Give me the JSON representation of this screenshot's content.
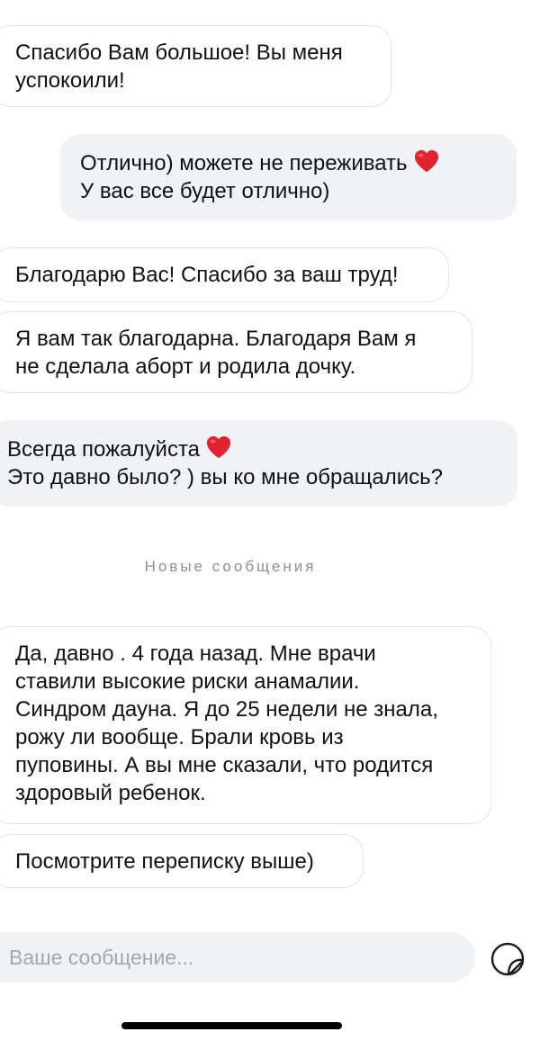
{
  "messages": [
    {
      "lines": [
        "Спасибо Вам большое! Вы меня",
        "успокоили!"
      ]
    },
    {
      "lines": [
        "Отлично) можете не переживать",
        "У вас все будет отлично)"
      ],
      "emoji": "heart-emoji"
    },
    {
      "lines": [
        "Благодарю Вас! Спасибо за ваш труд!"
      ]
    },
    {
      "lines": [
        "Я вам так благодарна. Благодаря Вам я",
        "не сделала аборт и родила дочку."
      ]
    },
    {
      "lines": [
        "Всегда пожалуйста",
        "Это давно было? ) вы ко мне обращались?"
      ],
      "emoji": "heart-emoji"
    },
    {
      "lines": [
        "Да, давно . 4 года назад. Мне врачи",
        "ставили высокие риски анамалии.",
        "Синдром дауна. Я до 25 недели не знала,",
        "рожу ли вообще. Брали кровь из",
        "пуповины. А вы мне сказали, что родится",
        "здоровый ребенок."
      ]
    },
    {
      "lines": [
        "Посмотрите переписку выше)"
      ]
    }
  ],
  "divider": {
    "label": "Новые сообщения"
  },
  "composer": {
    "placeholder": "Ваше сообщение...",
    "icon": "sticker-icon"
  },
  "colors": {
    "outgoing_bubble": "#f1f2f5",
    "incoming_border": "#e3e3e6",
    "divider_text": "#8e8e93",
    "heart": "#e0242f"
  }
}
